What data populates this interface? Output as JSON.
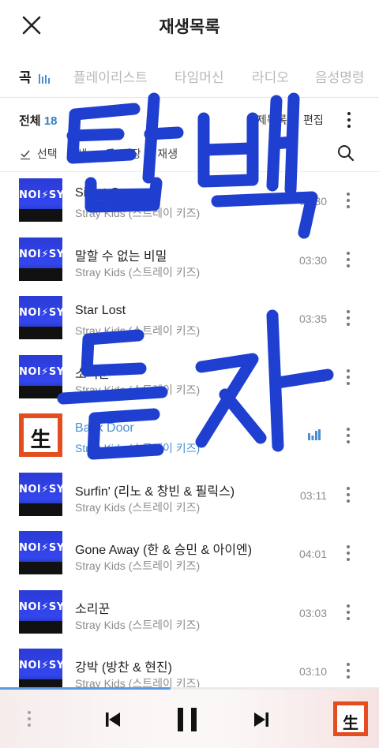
{
  "header": {
    "title": "재생목록",
    "close_icon": "close-icon"
  },
  "tabs": [
    {
      "label": "곡",
      "active": true
    },
    {
      "label": "플레이리스트",
      "active": false
    },
    {
      "label": "타임머신",
      "active": false
    },
    {
      "label": "라디오",
      "active": false
    },
    {
      "label": "음성명령",
      "active": false
    }
  ],
  "subbar": {
    "total_label": "전체",
    "total_count": "18",
    "delete_label": "삭제목록",
    "edit_label": "편집"
  },
  "actions": {
    "select_label": "선택",
    "play_label": "재생",
    "save_play_label": "저장 후 재생"
  },
  "songs": [
    {
      "title": "Silent Cry",
      "artist": "Stray Kids (스트레이 키즈)",
      "duration": "03:30",
      "art": "noeasy",
      "playing": false
    },
    {
      "title": "말할 수 없는 비밀",
      "artist": "Stray Kids (스트레이 키즈)",
      "duration": "03:30",
      "art": "noeasy",
      "playing": false
    },
    {
      "title": "Star Lost",
      "artist": "Stray Kids (스트레이 키즈)",
      "duration": "03:35",
      "art": "noeasy",
      "playing": false
    },
    {
      "title": "소리꾼",
      "artist": "Stray Kids (스트레이 키즈)",
      "duration": "03:03",
      "art": "noeasy",
      "playing": false
    },
    {
      "title": "Back Door",
      "artist": "Stray Kids (스트레이 키즈)",
      "duration": "",
      "art": "saeng",
      "playing": true
    },
    {
      "title": "Surfin' (리노 & 창빈 & 필릭스)",
      "artist": "Stray Kids (스트레이 키즈)",
      "duration": "03:11",
      "art": "noeasy",
      "playing": false
    },
    {
      "title": "Gone Away (한 & 승민 & 아이엔)",
      "artist": "Stray Kids (스트레이 키즈)",
      "duration": "04:01",
      "art": "noeasy",
      "playing": false
    },
    {
      "title": "소리꾼",
      "artist": "Stray Kids (스트레이 키즈)",
      "duration": "03:03",
      "art": "noeasy",
      "playing": false
    },
    {
      "title": "강박 (방찬 & 현진)",
      "artist": "Stray Kids (스트레이 키즈)",
      "duration": "03:10",
      "art": "noeasy",
      "playing": false
    }
  ],
  "album_art_text": {
    "noeasy": "NOI⚡SY",
    "saeng": "生"
  },
  "watermark": {
    "line1": "탑백",
    "line2": "듣자",
    "color": "#1f3fd0"
  },
  "player": {
    "progress": 0.45,
    "prev_icon": "skip-previous-icon",
    "pause_icon": "pause-icon",
    "next_icon": "skip-next-icon"
  },
  "colors": {
    "accent": "#4a8fd0",
    "total_count": "#3b7fc0",
    "noeasy_art": "#3346ee",
    "saeng_art": "#e44d20"
  }
}
